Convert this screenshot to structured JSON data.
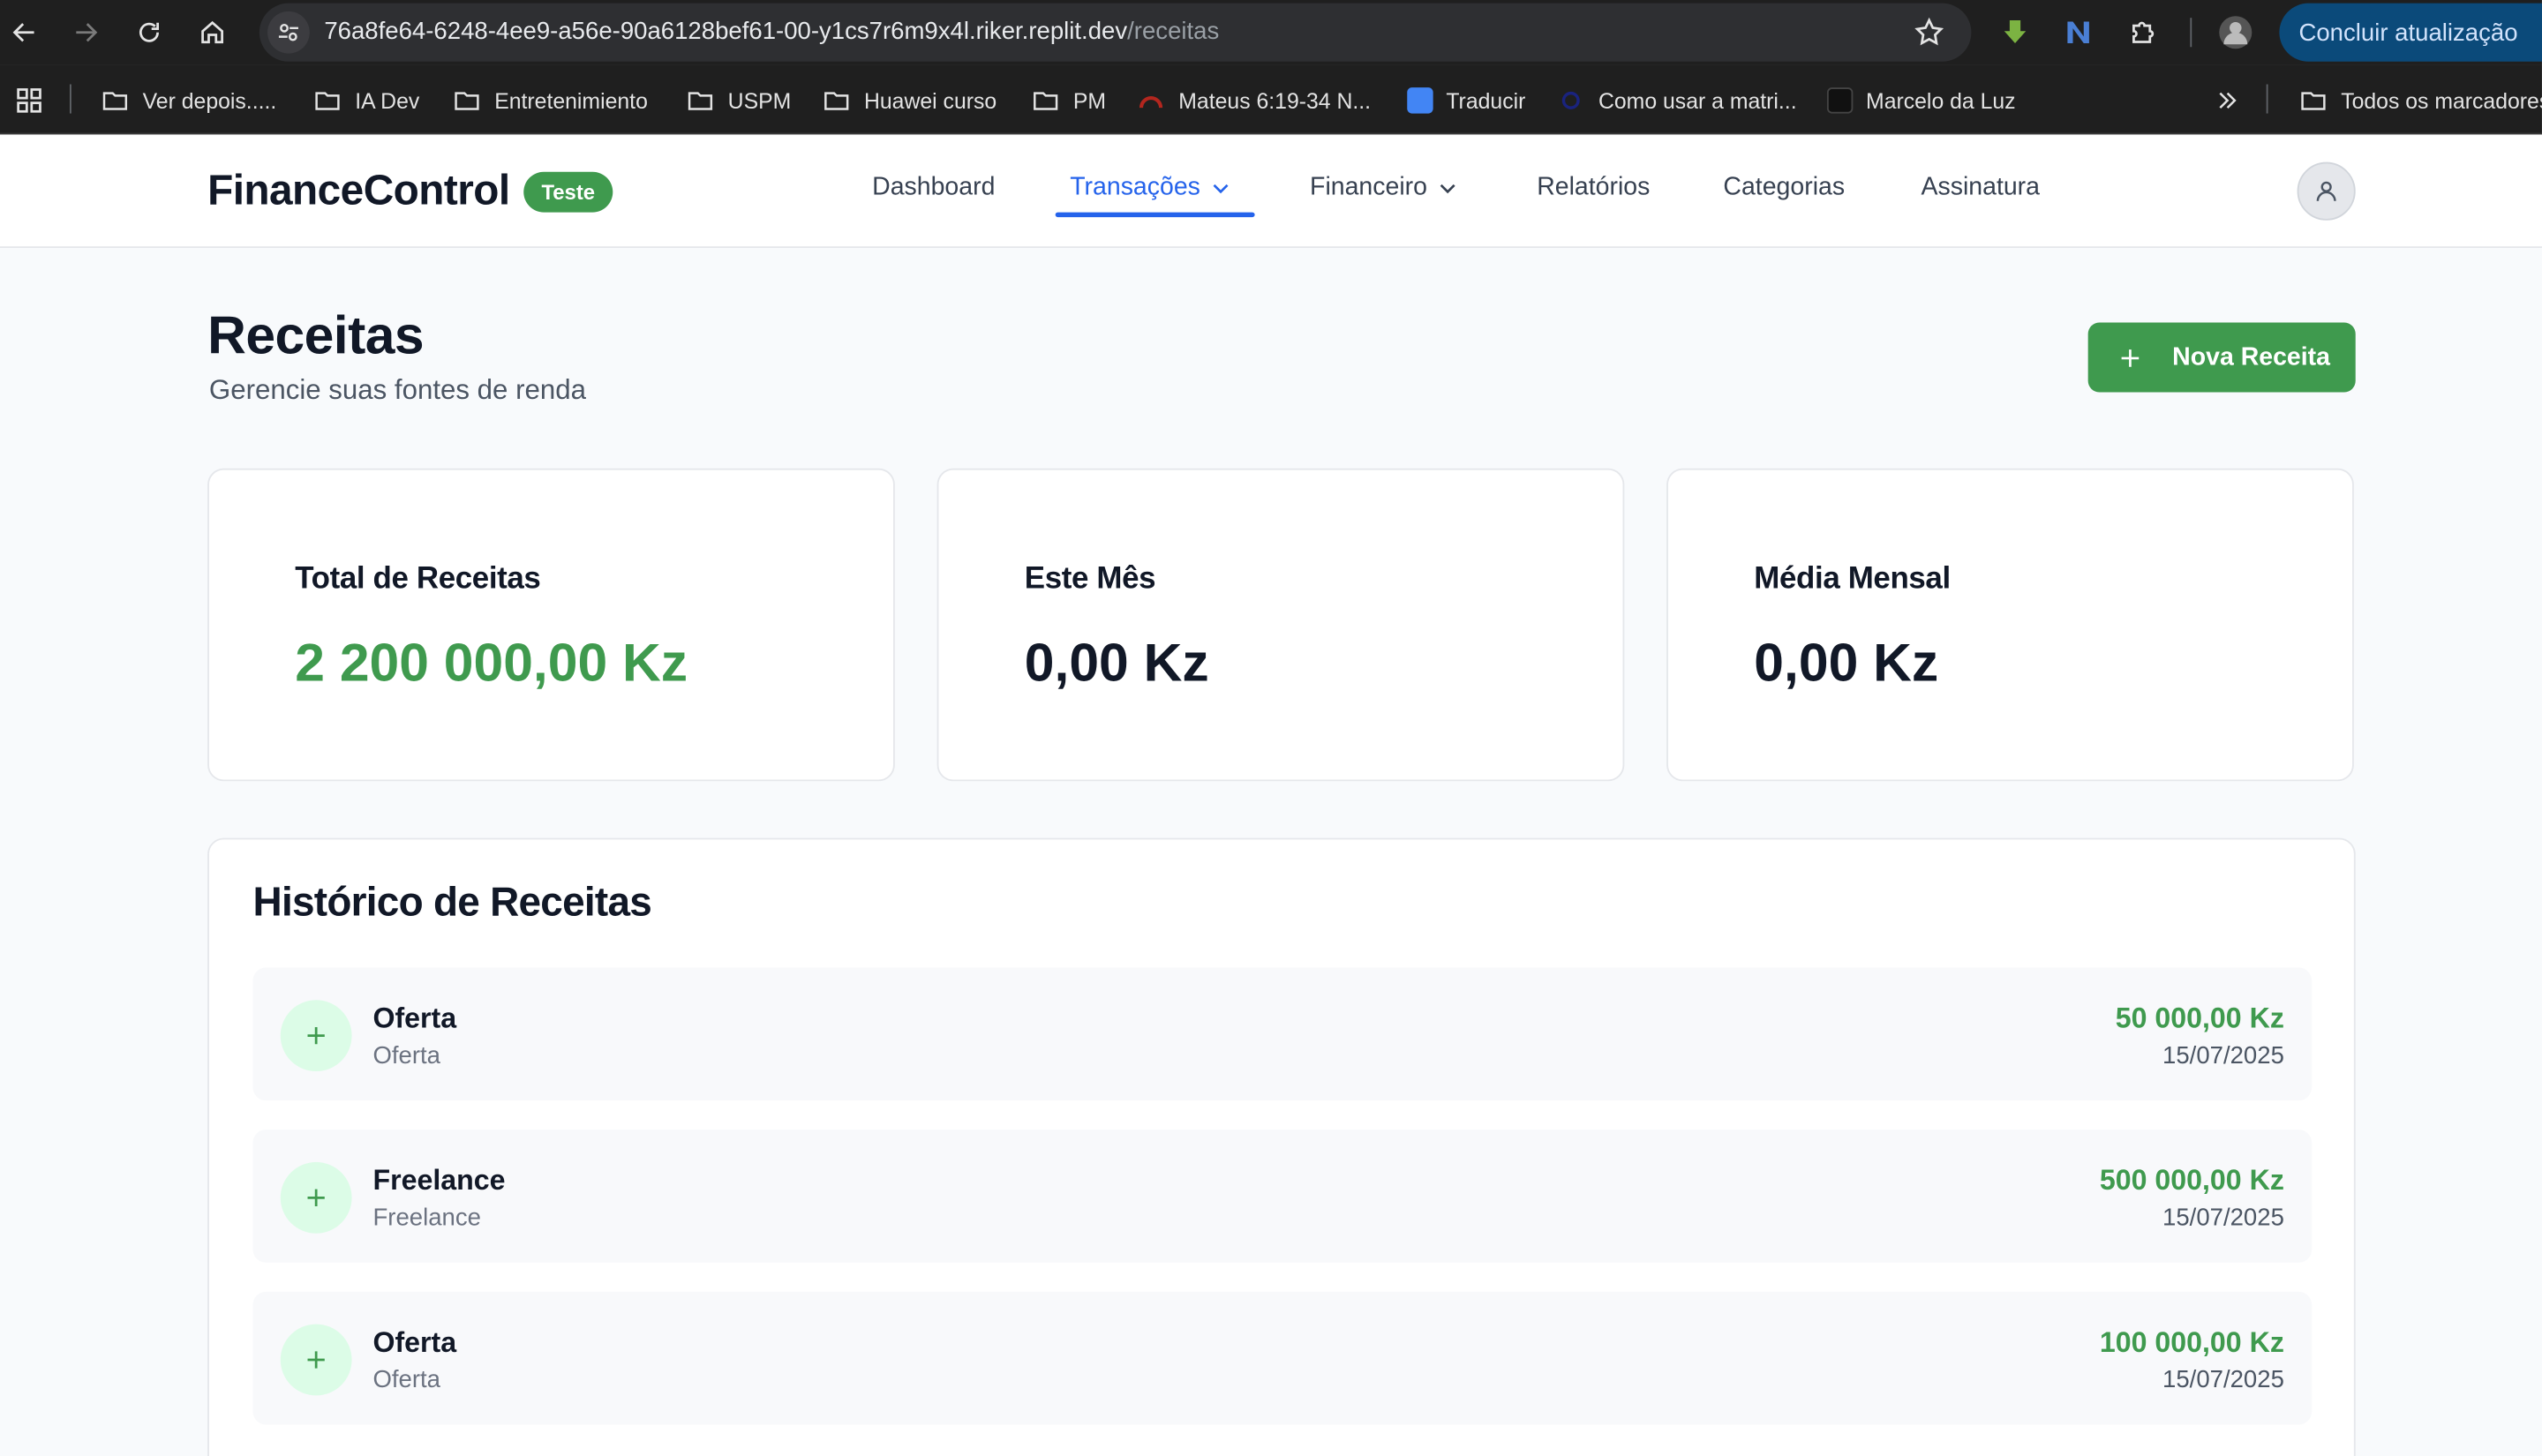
{
  "browser": {
    "url_host": "76a8fe64-6248-4ee9-a56e-90a6128bef61-00-y1cs7r6m9x4l.riker.replit.dev",
    "url_path": "/receitas",
    "update_label": "Concluir atualização",
    "bookmarks": [
      {
        "label": "Ver depois.....",
        "icon": "folder-icon"
      },
      {
        "label": "IA Dev",
        "icon": "folder-icon"
      },
      {
        "label": "Entretenimiento",
        "icon": "folder-icon"
      },
      {
        "label": "USPM",
        "icon": "folder-icon"
      },
      {
        "label": "Huawei curso",
        "icon": "folder-icon"
      },
      {
        "label": "PM",
        "icon": "folder-icon"
      },
      {
        "label": "Mateus 6:19-34 N...",
        "icon": "site-icon"
      },
      {
        "label": "Traducir",
        "icon": "translate-icon"
      },
      {
        "label": "Como usar a matri...",
        "icon": "site-icon"
      },
      {
        "label": "Marcelo da Luz",
        "icon": "site-icon"
      }
    ],
    "all_bookmarks_label": "Todos os marcadores"
  },
  "header": {
    "brand": "FinanceControl",
    "badge": "Teste",
    "nav": [
      {
        "label": "Dashboard",
        "active": false
      },
      {
        "label": "Transações",
        "active": true,
        "dropdown": true
      },
      {
        "label": "Financeiro",
        "active": false,
        "dropdown": true
      },
      {
        "label": "Relatórios",
        "active": false
      },
      {
        "label": "Categorias",
        "active": false
      },
      {
        "label": "Assinatura",
        "active": false
      }
    ]
  },
  "page": {
    "title": "Receitas",
    "subtitle": "Gerencie suas fontes de renda",
    "new_button": "Nova Receita"
  },
  "stats": [
    {
      "label": "Total de Receitas",
      "value": "2 200 000,00 Kz",
      "color": "#3f9a4e"
    },
    {
      "label": "Este Mês",
      "value": "0,00 Kz",
      "color": "#111827"
    },
    {
      "label": "Média Mensal",
      "value": "0,00 Kz",
      "color": "#111827"
    }
  ],
  "history": {
    "title": "Histórico de Receitas",
    "items": [
      {
        "title": "Oferta",
        "category": "Oferta",
        "amount": "50 000,00 Kz",
        "date": "15/07/2025"
      },
      {
        "title": "Freelance",
        "category": "Freelance",
        "amount": "500 000,00 Kz",
        "date": "15/07/2025"
      },
      {
        "title": "Oferta",
        "category": "Oferta",
        "amount": "100 000,00 Kz",
        "date": "15/07/2025"
      }
    ]
  },
  "colors": {
    "accent_green": "#3f9a4e",
    "active_blue": "#2563eb"
  }
}
